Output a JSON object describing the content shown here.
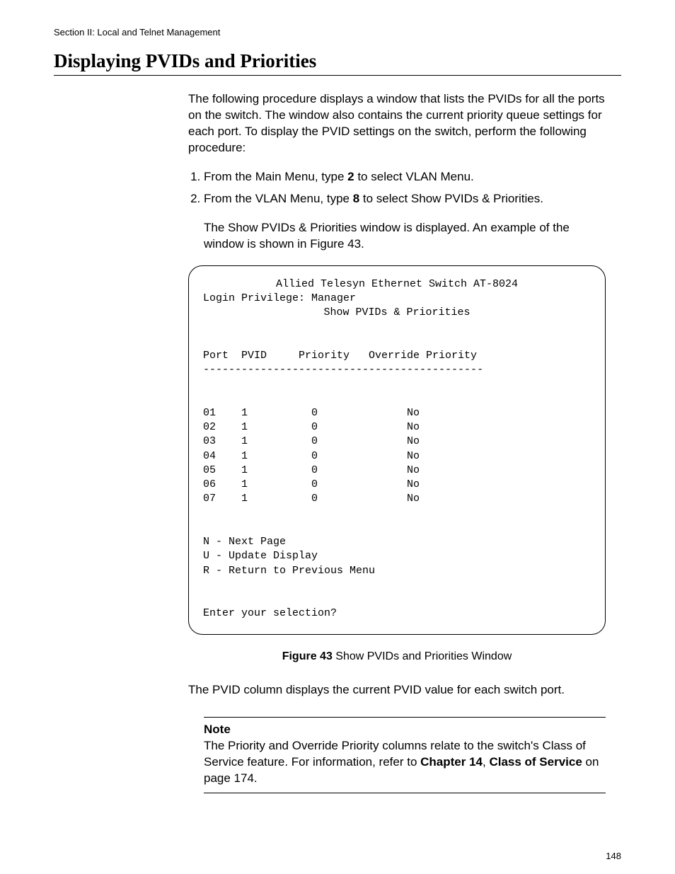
{
  "header": {
    "section_label": "Section II: Local and Telnet Management"
  },
  "title": "Displaying PVIDs and Priorities",
  "intro": "The following procedure displays a window that lists the PVIDs for all the ports on the switch. The window also contains the current priority queue settings for each port. To display the PVID settings on the switch, perform the following procedure:",
  "steps": {
    "s1_pre": "From the Main Menu, type ",
    "s1_bold": "2",
    "s1_post": " to select VLAN Menu.",
    "s2_pre": "From the VLAN Menu, type ",
    "s2_bold": "8",
    "s2_post": " to select Show PVIDs & Priorities."
  },
  "followup": "The Show PVIDs & Priorities window is displayed. An example of the window is shown in Figure 43.",
  "terminal": {
    "line1": "Allied Telesyn Ethernet Switch AT-8024",
    "line2": "Login Privilege: Manager",
    "line3": "Show PVIDs & Priorities",
    "header_row": "Port  PVID     Priority   Override Priority",
    "sep": "--------------------------------------------",
    "rows": [
      "01    1          0              No",
      "02    1          0              No",
      "03    1          0              No",
      "04    1          0              No",
      "05    1          0              No",
      "06    1          0              No",
      "07    1          0              No"
    ],
    "opt_n": "N - Next Page",
    "opt_u": "U - Update Display",
    "opt_r": "R - Return to Previous Menu",
    "prompt": "Enter your selection?"
  },
  "figure": {
    "label": "Figure 43",
    "caption": "  Show PVIDs and Priorities Window"
  },
  "post": "The PVID column displays the current PVID value for each switch port.",
  "note": {
    "label": "Note",
    "pre": "The Priority and Override Priority columns relate to the switch's Class of Service feature. For information, refer to ",
    "b1": "Chapter 14",
    "mid": ", ",
    "b2": "Class of Service",
    "post": " on page 174."
  },
  "page_number": "148"
}
